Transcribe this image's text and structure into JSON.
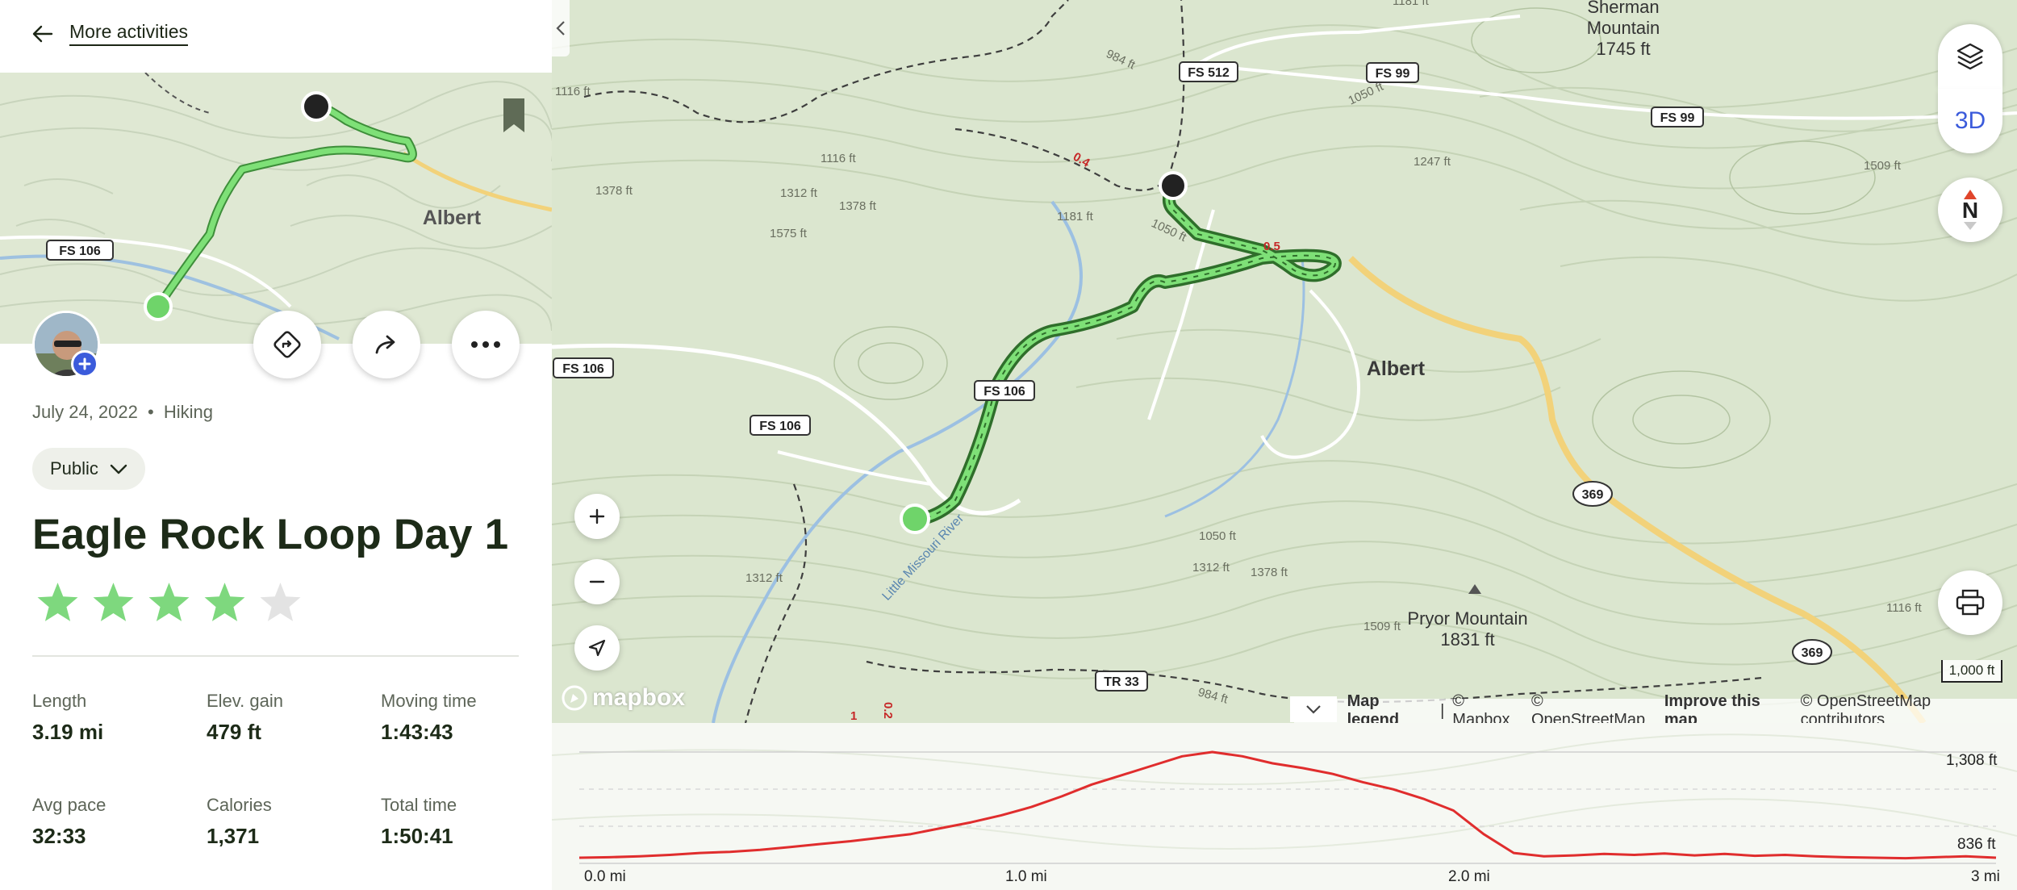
{
  "nav": {
    "back_label": "More activities"
  },
  "thumbnail": {
    "town_label": "Albert",
    "road_label": "FS 106"
  },
  "activity": {
    "date": "July 24, 2022",
    "separator": "•",
    "type": "Hiking",
    "privacy": "Public",
    "title": "Eagle Rock Loop Day 1",
    "rating": 4,
    "rating_max": 5,
    "star_color": "#7ed87e",
    "star_empty_color": "#e3e3e3"
  },
  "stats": [
    {
      "label": "Length",
      "value": "3.19 mi"
    },
    {
      "label": "Elev. gain",
      "value": "479 ft"
    },
    {
      "label": "Moving time",
      "value": "1:43:43"
    },
    {
      "label": "Avg pace",
      "value": "32:33"
    },
    {
      "label": "Calories",
      "value": "1,371"
    },
    {
      "label": "Total time",
      "value": "1:50:41"
    }
  ],
  "map": {
    "labels": {
      "sherman_name": "Sherman",
      "sherman_name2": "Mountain",
      "sherman_elev": "1745 ft",
      "albert": "Albert",
      "pryor_name": "Pryor Mountain",
      "pryor_elev": "1831 ft",
      "river": "Little Missouri River"
    },
    "road_shields": {
      "fs512": "FS 512",
      "fs99a": "FS 99",
      "fs99b": "FS 99",
      "fs106a": "FS 106",
      "fs106b": "FS 106",
      "fs106c": "FS 106",
      "tr33": "TR 33",
      "r369a": "369",
      "r369b": "369"
    },
    "contours": {
      "c1": "1116 ft",
      "c2": "984 ft",
      "c3": "1050 ft",
      "c4": "1378 ft",
      "c5": "1312 ft",
      "c6": "1378 ft",
      "c7": "1116 ft",
      "c8": "1575 ft",
      "c9": "1181 ft",
      "c10": "1050 ft",
      "c11": "1247 ft",
      "c12": "1509 ft",
      "c13": "1050 ft",
      "c14": "1312 ft",
      "c15": "1378 ft",
      "c16": "1312 ft",
      "c17": "1509 ft",
      "c18": "1116 ft",
      "c19": "984 ft",
      "c20": "1181 ft"
    },
    "mile_markers": {
      "m1": "0.4",
      "m2": "0.5",
      "m3": "0.2",
      "m4": "1"
    },
    "mapbox": "mapbox",
    "three_d": "3D",
    "north": "N",
    "scale": "1,000 ft",
    "attribution": {
      "legend": "Map legend",
      "sep": "|",
      "mapbox": "© Mapbox",
      "osm": "© OpenStreetMap",
      "improve": "Improve this map",
      "osm2": "© OpenStreetMap contributors"
    },
    "route_color": "#6fd46a",
    "start_color": "#6fd46a",
    "end_color": "#222222"
  },
  "elevation": {
    "y_max_label": "1,308 ft",
    "y_min_label": "836 ft",
    "x_labels": [
      "0.0 mi",
      "1.0 mi",
      "2.0 mi",
      "3 mi"
    ],
    "line_color": "#e02d2d",
    "profile_ft": [
      860,
      862,
      866,
      872,
      880,
      885,
      893,
      905,
      918,
      930,
      945,
      960,
      985,
      1010,
      1040,
      1075,
      1120,
      1170,
      1210,
      1250,
      1290,
      1308,
      1290,
      1260,
      1240,
      1215,
      1180,
      1150,
      1110,
      1060,
      960,
      880,
      866,
      870,
      876,
      872,
      878,
      870,
      876,
      868,
      872,
      866,
      862,
      860,
      858,
      862,
      866,
      860
    ]
  }
}
